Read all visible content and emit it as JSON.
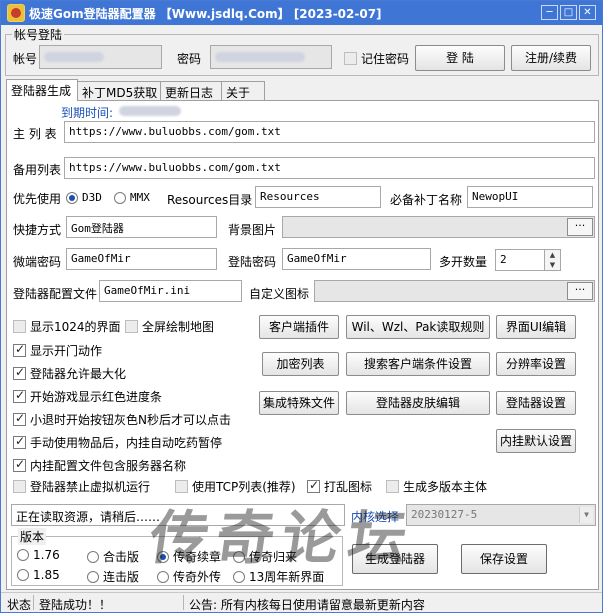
{
  "window": {
    "title": "极速Gom登陆器配置器  【Www.jsdlq.Com】  [2023-02-07]",
    "controls": [
      "─",
      "□",
      "✕"
    ],
    "accent_color": "#3f76d6"
  },
  "account": {
    "group_label": "帐号登陆",
    "username_label": "帐号",
    "password_label": "密码",
    "remember_label": "记住密码",
    "remember_checked": false,
    "login_button": "登 陆",
    "register_button": "注册/续费"
  },
  "tabs": [
    {
      "label": "登陆器生成",
      "active": true
    },
    {
      "label": "补丁MD5获取",
      "active": false
    },
    {
      "label": "更新日志",
      "active": false
    },
    {
      "label": "关于",
      "active": false
    }
  ],
  "form": {
    "expire_label": "到期时间:",
    "main_list_label": "主 列 表",
    "main_list_value": "https://www.buluobbs.com/gom.txt",
    "backup_list_label": "备用列表",
    "backup_list_value": "https://www.buluobbs.com/gom.txt",
    "priority_label": "优先使用",
    "priority_options": [
      {
        "label": "D3D",
        "selected": true
      },
      {
        "label": "MMX",
        "selected": false
      }
    ],
    "resources_label": "Resources目录",
    "resources_value": "Resources",
    "required_patch_label": "必备补丁名称",
    "required_patch_value": "NewopUI",
    "shortcut_label": "快捷方式",
    "shortcut_value": "Gom登陆器",
    "bg_image_label": "背景图片",
    "bg_image_value": "",
    "micro_key_label": "微端密码",
    "micro_key_value": "GameOfMir",
    "login_key_label": "登陆密码",
    "login_key_value": "GameOfMir",
    "multi_open_label": "多开数量",
    "multi_open_value": "2",
    "config_file_label": "登陆器配置文件",
    "config_file_value": "GameOfMir.ini",
    "custom_icon_label": "自定义图标",
    "custom_icon_value": "",
    "browse_label": "···"
  },
  "options": [
    {
      "label": "显示1024的界面",
      "checked": false,
      "disabled": true
    },
    {
      "label": "全屏绘制地图",
      "checked": false,
      "disabled": true
    },
    {
      "label": "显示开门动作",
      "checked": true,
      "disabled": false
    },
    {
      "label": "登陆器允许最大化",
      "checked": true,
      "disabled": false
    },
    {
      "label": "开始游戏显示红色进度条",
      "checked": true,
      "disabled": false
    },
    {
      "label": "小退时开始按钮灰色N秒后才可以点击",
      "checked": true,
      "disabled": false
    },
    {
      "label": "手动使用物品后，内挂自动吃药暂停",
      "checked": true,
      "disabled": false
    },
    {
      "label": "内挂配置文件包含服务器名称",
      "checked": true,
      "disabled": false
    },
    {
      "label": "登陆器禁止虚拟机运行",
      "checked": false,
      "disabled": true
    },
    {
      "label": "使用TCP列表(推荐)",
      "checked": false,
      "disabled": true
    },
    {
      "label": "打乱图标",
      "checked": true,
      "disabled": false
    },
    {
      "label": "生成多版本主体",
      "checked": false,
      "disabled": true
    }
  ],
  "buttons": {
    "client_plugin": "客户端插件",
    "wil_rules": "Wil、Wzl、Pak读取规则",
    "ui_edit": "界面UI编辑",
    "encrypt_list": "加密列表",
    "search_client": "搜索客户端条件设置",
    "resolution": "分辨率设置",
    "integrate_files": "集成特殊文件",
    "skin_edit": "登陆器皮肤编辑",
    "launcher_settings": "登陆器设置",
    "plugin_default": "内挂默认设置",
    "generate": "生成登陆器",
    "save": "保存设置"
  },
  "status_area": {
    "message": "正在读取资源，请稍后……",
    "kernel_label": "内核选择",
    "kernel_value": "20230127-5"
  },
  "version": {
    "group_label": "版本",
    "options": [
      {
        "label": "1.76",
        "selected": false
      },
      {
        "label": "合击版",
        "selected": false
      },
      {
        "label": "传奇续章",
        "selected": true
      },
      {
        "label": "传奇归来",
        "selected": false
      },
      {
        "label": "1.85",
        "selected": false
      },
      {
        "label": "连击版",
        "selected": false
      },
      {
        "label": "传奇外传",
        "selected": false
      },
      {
        "label": "13周年新界面",
        "selected": false
      }
    ]
  },
  "statusbar": {
    "label": "状态",
    "message": "登陆成功！！",
    "notice": "公告: 所有内核每日使用请留意最新更新内容"
  },
  "watermark_text": "传奇论坛"
}
